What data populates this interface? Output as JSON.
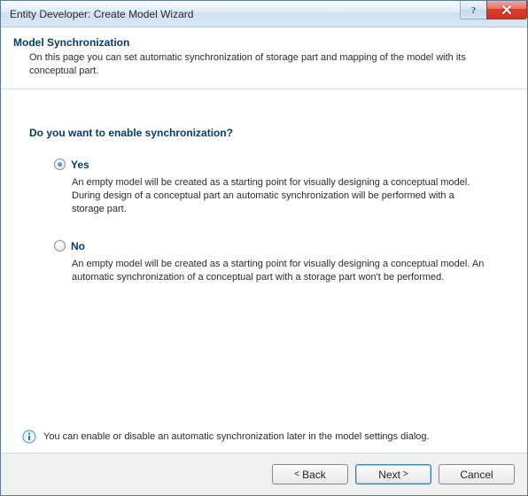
{
  "window": {
    "title": "Entity Developer: Create Model Wizard"
  },
  "header": {
    "title": "Model Synchronization",
    "subtitle": "On this page you can set automatic synchronization of storage part and mapping of the model with its conceptual part."
  },
  "content": {
    "question": "Do you want to enable synchronization?",
    "options": [
      {
        "label": "Yes",
        "selected": true,
        "description": "An empty model will be created as a starting point for visually designing a conceptual model. During design of a conceptual part an automatic synchronization will be performed with a storage part."
      },
      {
        "label": "No",
        "selected": false,
        "description": "An empty model will be created as a starting point for visually designing a conceptual model. An automatic synchronization of a conceptual part with a storage part won't be performed."
      }
    ]
  },
  "info": {
    "text": "You can enable or disable an automatic synchronization later in the model settings dialog."
  },
  "footer": {
    "back": "Back",
    "next": "Next",
    "cancel": "Cancel"
  }
}
